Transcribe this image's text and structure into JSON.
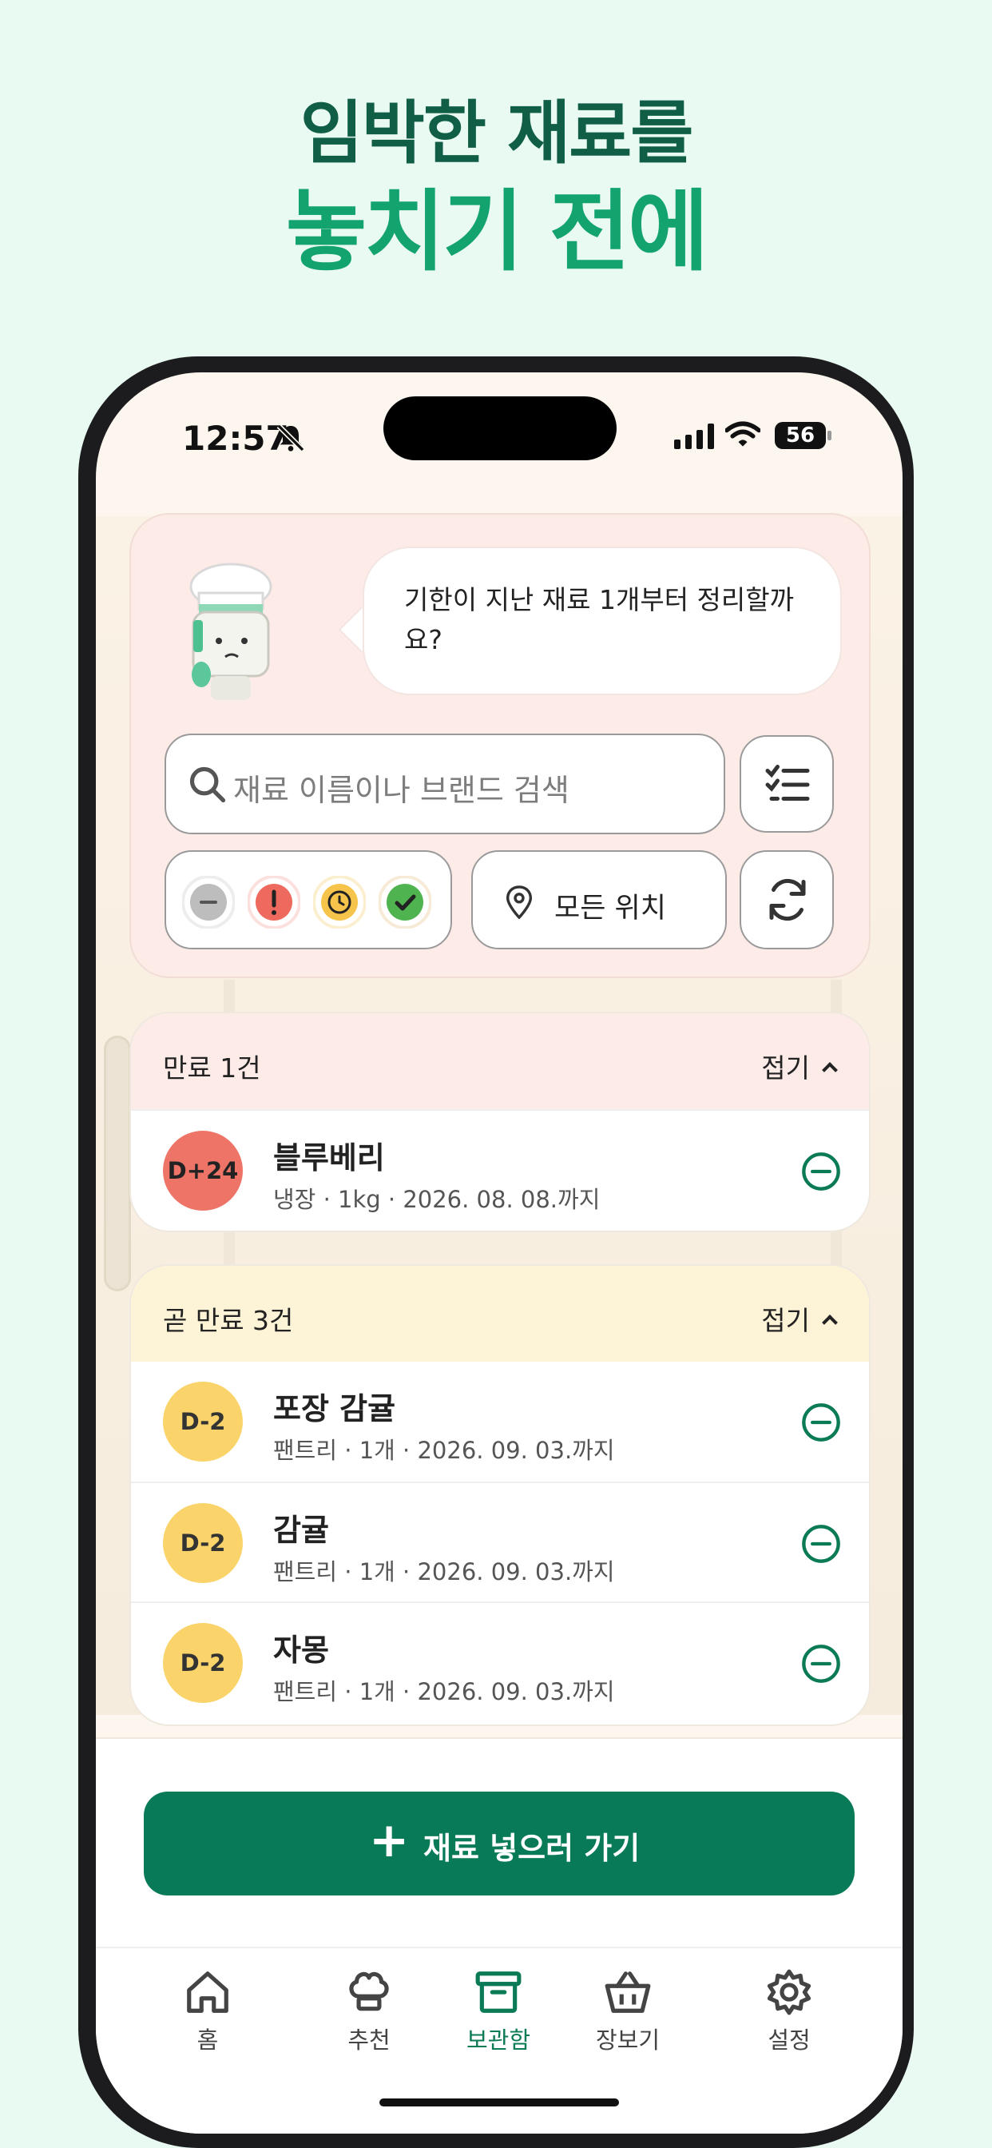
{
  "promo": {
    "line1": "임박한 재료를",
    "line2": "놓치기 전에"
  },
  "status_bar": {
    "time": "12:57",
    "battery": "56"
  },
  "assistant": {
    "message": "기한이 지난 재료 1개부터 정리할까요?"
  },
  "search": {
    "placeholder": "재료 이름이나 브랜드 검색"
  },
  "filters": {
    "location_label": "모든 위치",
    "status_chips": [
      {
        "icon": "minus-circle-icon",
        "color": "#BDBDBD",
        "ring": "#EDEDED"
      },
      {
        "icon": "exclamation-icon",
        "color": "#EE6A5E",
        "ring": "#FBE0DD"
      },
      {
        "icon": "clock-icon",
        "color": "#F6C44A",
        "ring": "#FCEFD0"
      },
      {
        "icon": "check-icon",
        "color": "#4FB44F",
        "ring": "#F7EBD8"
      }
    ]
  },
  "sections": [
    {
      "title": "만료 1건",
      "fold_label": "접기",
      "header_bg": "#FDEBE8",
      "items": [
        {
          "badge": "D+24",
          "badge_color": "#EE7468",
          "badge_text_color": "#222222",
          "name": "블루베리",
          "meta": "냉장 · 1kg · 2026. 08. 08.까지"
        }
      ]
    },
    {
      "title": "곧 만료 3건",
      "fold_label": "접기",
      "header_bg": "#FDF3D6",
      "items": [
        {
          "badge": "D-2",
          "badge_color": "#FAD46A",
          "badge_text_color": "#333333",
          "name": "포장 감귤",
          "meta": "팬트리 · 1개 · 2026. 09. 03.까지"
        },
        {
          "badge": "D-2",
          "badge_color": "#FAD46A",
          "badge_text_color": "#333333",
          "name": "감귤",
          "meta": "팬트리 · 1개 · 2026. 09. 03.까지"
        },
        {
          "badge": "D-2",
          "badge_color": "#FAD46A",
          "badge_text_color": "#333333",
          "name": "자몽",
          "meta": "팬트리 · 1개 · 2026. 09. 03.까지"
        }
      ]
    }
  ],
  "cta": {
    "label": "재료 넣으러 가기"
  },
  "tabs": [
    {
      "label": "홈",
      "icon": "home-icon"
    },
    {
      "label": "추천",
      "icon": "chef-hat-icon"
    },
    {
      "label": "보관함",
      "icon": "archive-box-icon",
      "active": true
    },
    {
      "label": "장보기",
      "icon": "basket-icon"
    },
    {
      "label": "설정",
      "icon": "gear-icon"
    }
  ],
  "colors": {
    "accent": "#087A58",
    "promo_dark": "#0F5E45",
    "promo_green": "#13A36E",
    "page_bg": "#E9FAF2"
  }
}
